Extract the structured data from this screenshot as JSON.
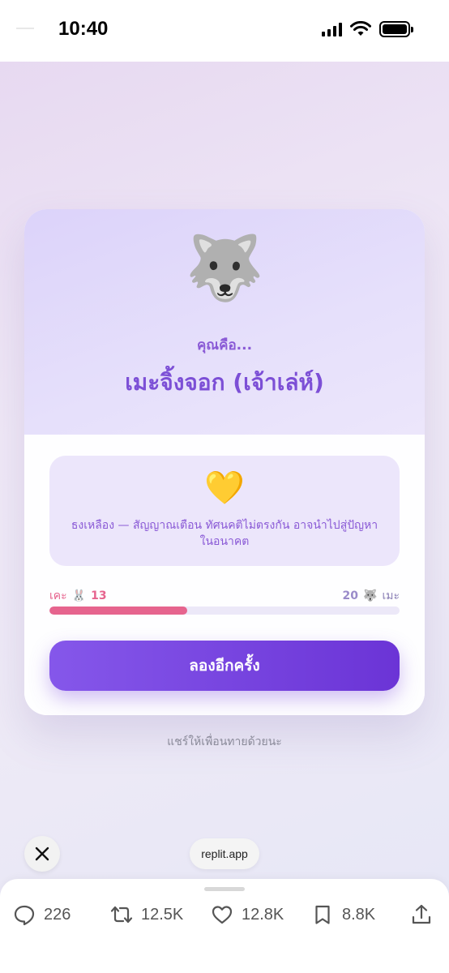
{
  "status_bar": {
    "time": "10:40"
  },
  "result": {
    "emoji": "🐺",
    "you_are": "คุณคือ...",
    "name": "เมะจิ้งจอก (เจ้าเล่ห์)"
  },
  "flag": {
    "emoji": "💛",
    "text": "ธงเหลือง — สัญญาณเตือน ทัศนคติไม่ตรงกัน อาจนำไปสู่ปัญหาในอนาคต"
  },
  "score": {
    "left_label": "เคะ",
    "left_emoji": "🐰",
    "left_value": "13",
    "right_value": "20",
    "right_emoji": "🐺",
    "right_label": "เมะ",
    "fill_fraction": 0.394
  },
  "retry_label": "ลองอีกครั้ง",
  "share_hint": "แชร์ให้เพื่อนทายด้วยนะ",
  "browser": {
    "url": "replit.app"
  },
  "post_actions": {
    "replies": "226",
    "reposts": "12.5K",
    "likes": "12.8K",
    "bookmarks": "8.8K"
  },
  "colors": {
    "accent": "#7c4fd6",
    "button": "#6b34d6",
    "score_pink": "#e6648e"
  }
}
